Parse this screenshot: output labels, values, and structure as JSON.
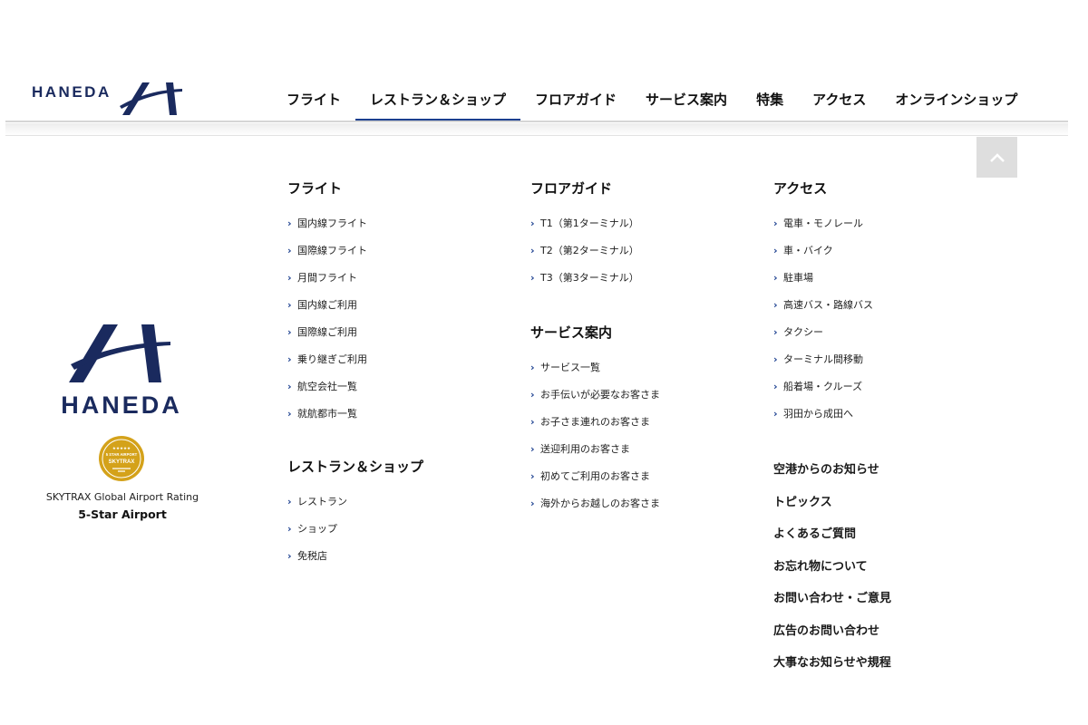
{
  "brand": {
    "logo_text": "HANEDA",
    "color": "#1a2a5e"
  },
  "nav": {
    "items": [
      "フライト",
      "レストラン＆ショップ",
      "フロアガイド",
      "サービス案内",
      "特集",
      "アクセス",
      "オンラインショップ"
    ],
    "active_index": 1,
    "accent_color": "#1b3f8f"
  },
  "scroll_top": {
    "icon": "chevron-up-icon"
  },
  "menu": {
    "flight": {
      "heading": "フライト",
      "items": [
        "国内線フライト",
        "国際線フライト",
        "月間フライト",
        "国内線ご利用",
        "国際線ご利用",
        "乗り継ぎご利用",
        "航空会社一覧",
        "就航都市一覧"
      ]
    },
    "restaurant": {
      "heading": "レストラン＆ショップ",
      "items": [
        "レストラン",
        "ショップ",
        "免税店"
      ]
    },
    "floor": {
      "heading": "フロアガイド",
      "items": [
        "T1（第1ターミナル）",
        "T2（第2ターミナル）",
        "T3（第3ターミナル）"
      ]
    },
    "service": {
      "heading": "サービス案内",
      "items": [
        "サービス一覧",
        "お手伝いが必要なお客さま",
        "お子さま連れのお客さま",
        "送迎利用のお客さま",
        "初めてご利用のお客さま",
        "海外からお越しのお客さま"
      ]
    },
    "access": {
      "heading": "アクセス",
      "items": [
        "電車・モノレール",
        "車・バイク",
        "駐車場",
        "高速バス・路線バス",
        "タクシー",
        "ターミナル間移動",
        "船着場・クルーズ",
        "羽田から成田へ"
      ]
    },
    "links": [
      "空港からのお知らせ",
      "トピックス",
      "よくあるご質問",
      "お忘れ物について",
      "お問い合わせ・ご意見",
      "広告のお問い合わせ",
      "大事なお知らせや規程"
    ]
  },
  "rating": {
    "badge_top_text": "5 STAR AIRPORT",
    "badge_brand": "SKYTRAX",
    "badge_color": "#d4a21a",
    "caption": "SKYTRAX Global Airport Rating",
    "title": "5-Star Airport"
  }
}
